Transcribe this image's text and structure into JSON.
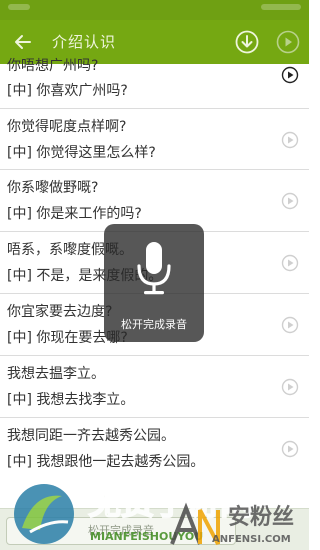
{
  "app_bar": {
    "title": "介绍认识",
    "back_icon": "arrow-left-icon",
    "download_icon": "download-circle-icon",
    "more_icon": "play-circle-icon"
  },
  "list": [
    {
      "cantonese": "你唔想广州吗?",
      "mandarin": "[中] 你喜欢广州吗?",
      "active": true
    },
    {
      "cantonese": "你觉得呢度点样啊?",
      "mandarin": "[中] 你觉得这里怎么样?",
      "active": false
    },
    {
      "cantonese": "你系嚟做野嘅?",
      "mandarin": "[中] 你是来工作的吗?",
      "active": false
    },
    {
      "cantonese": "唔系，系嚟度假嘅。",
      "mandarin": "[中] 不是，是来度假的。",
      "active": false
    },
    {
      "cantonese": "你宜家要去边度?",
      "mandarin": "[中] 你现在要去哪?",
      "active": false
    },
    {
      "cantonese": "我想去揾李立。",
      "mandarin": "[中] 我想去找李立。",
      "active": false
    },
    {
      "cantonese": "我想同距一齐去越秀公园。",
      "mandarin": "[中] 我想跟他一起去越秀公园。",
      "active": false
    }
  ],
  "overlay": {
    "icon": "microphone-icon",
    "text": "松开完成录音"
  },
  "bottom_bar": {
    "record_label": "松开完成录音"
  },
  "watermark": {
    "logo_icon": "watermark-logo-icon",
    "title": "免费手游网",
    "subtitle": "MIANFEISHOUYOU",
    "right_brand": "安粉丝",
    "right_subtitle": "ANFENSI.COM"
  },
  "colors": {
    "app_bar": "#75a812",
    "status_bar": "#6fa013",
    "overlay": "#282828"
  }
}
